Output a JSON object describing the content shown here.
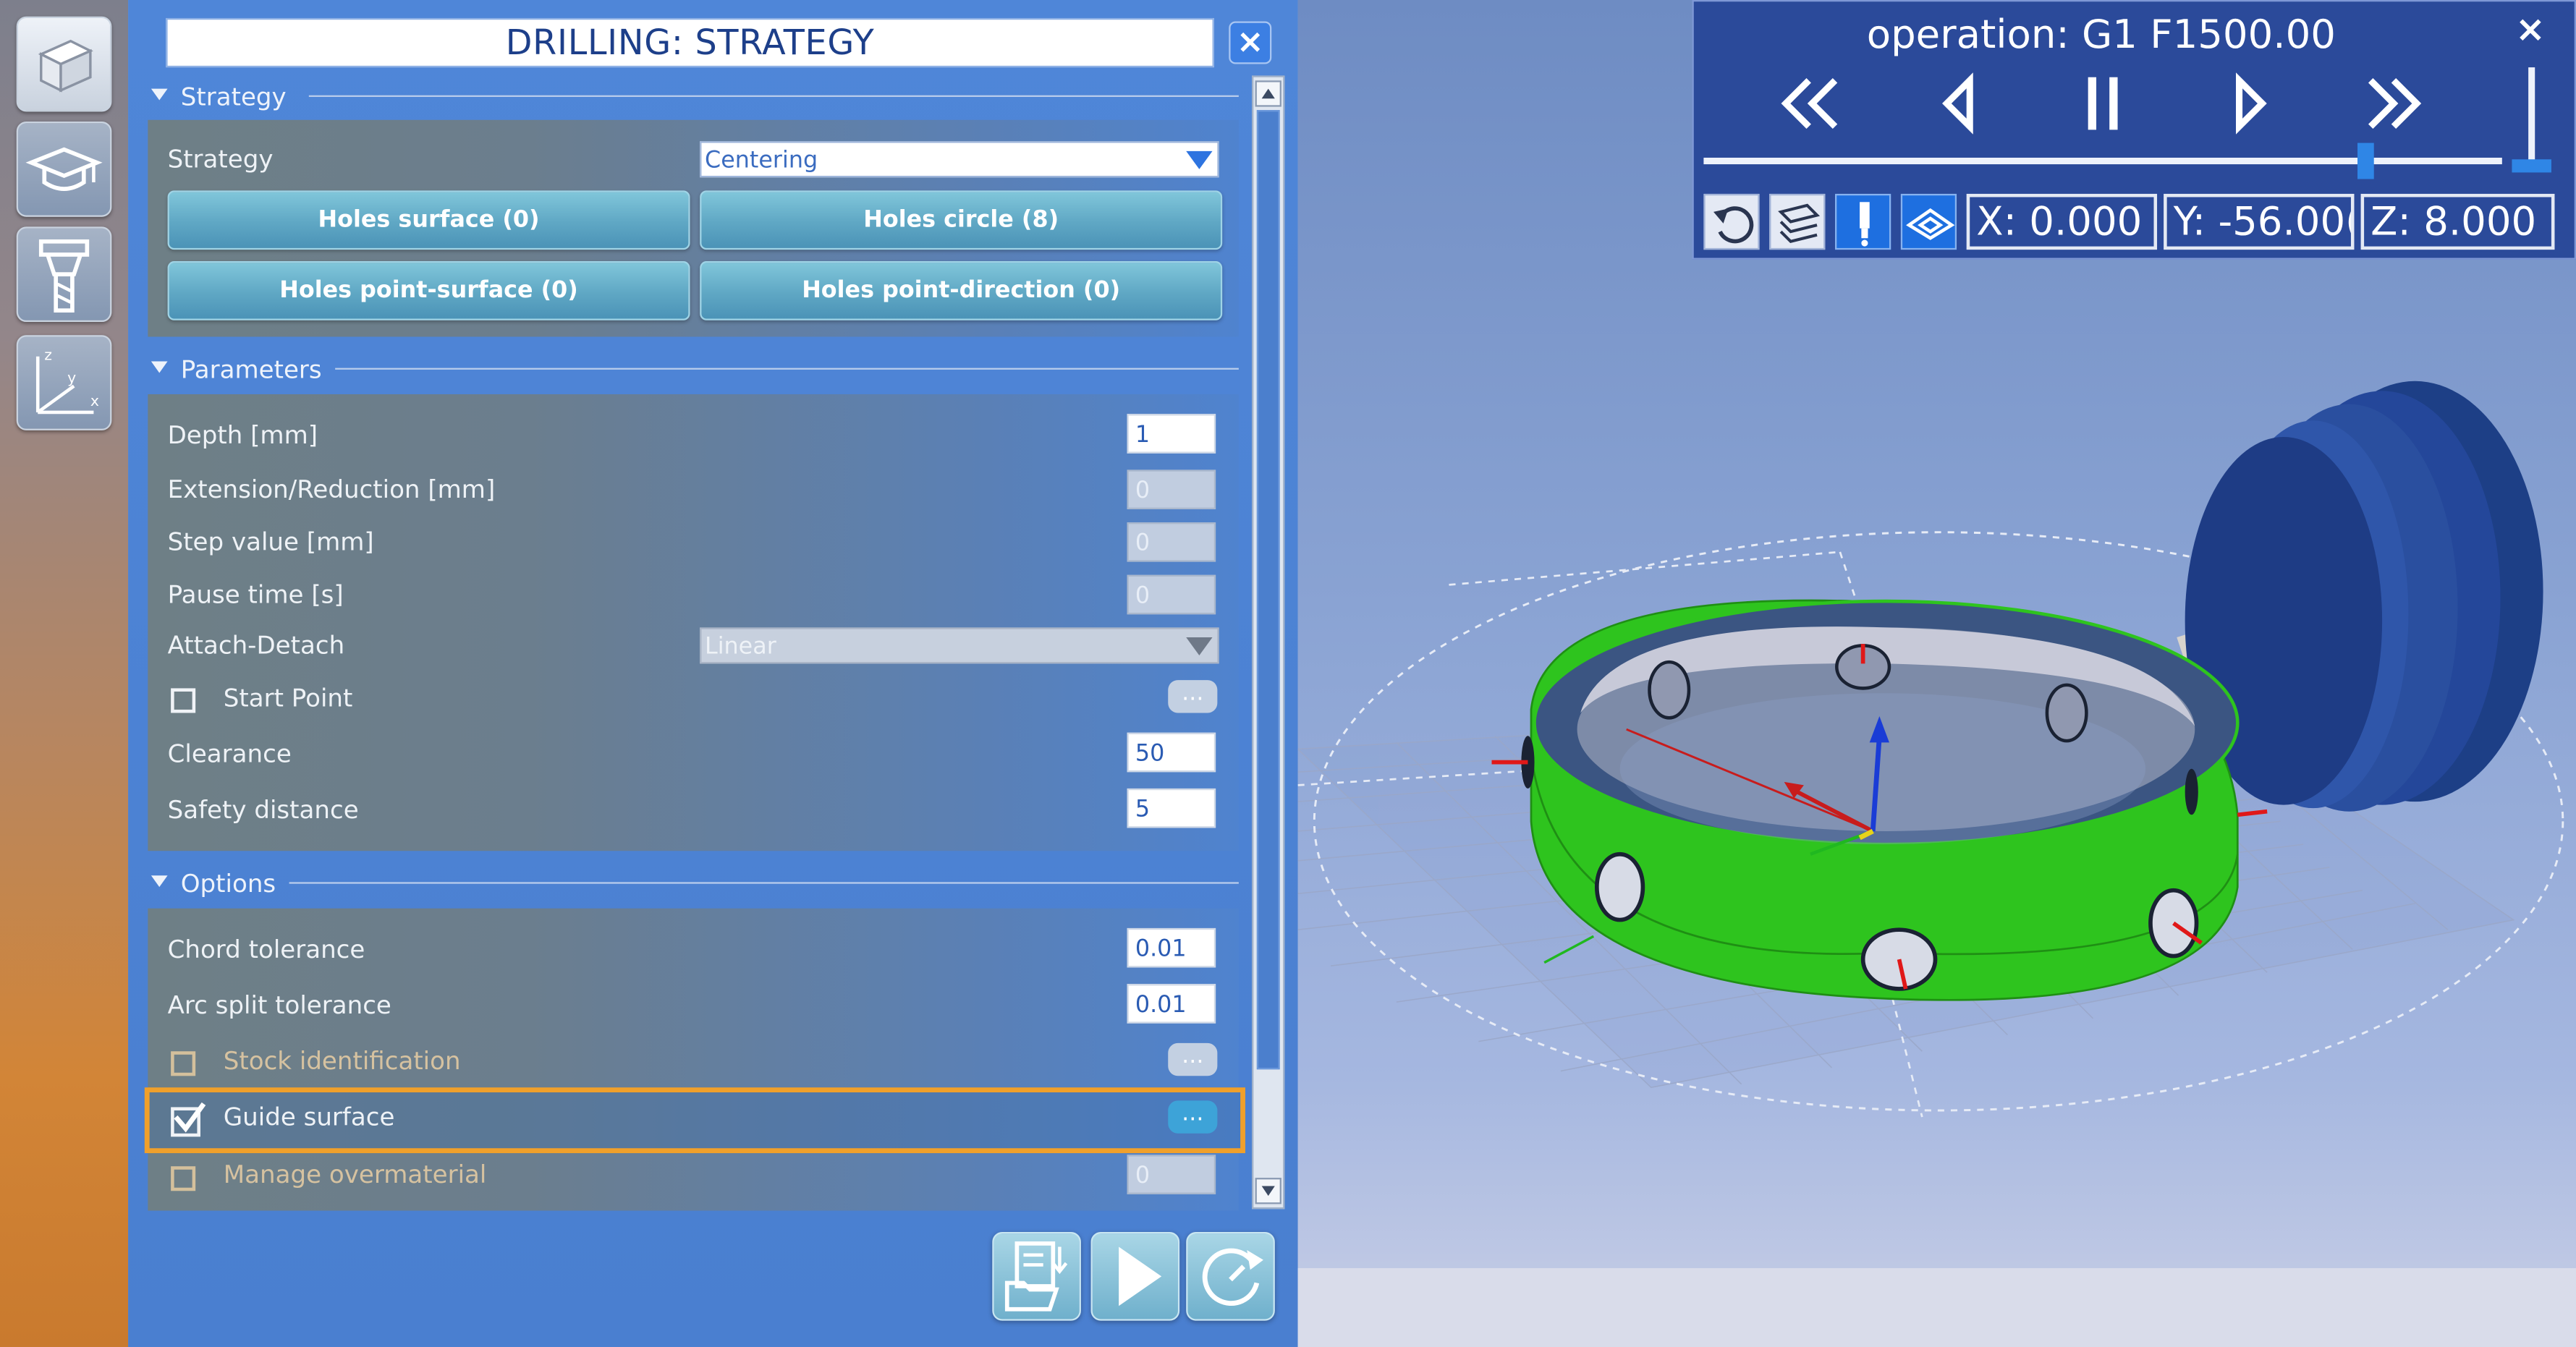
{
  "panel": {
    "title": "DRILLING: STRATEGY",
    "close_label": "×"
  },
  "sections": {
    "strategy": {
      "header": "Strategy",
      "strategy_label": "Strategy",
      "strategy_value": "Centering",
      "buttons": [
        "Holes surface (0)",
        "Holes circle (8)",
        "Holes point-surface (0)",
        "Holes point-direction (0)"
      ]
    },
    "parameters": {
      "header": "Parameters",
      "depth_label": "Depth [mm]",
      "depth_value": "1",
      "extension_label": "Extension/Reduction [mm]",
      "extension_value": "0",
      "step_label": "Step value [mm]",
      "step_value": "0",
      "pause_label": "Pause time [s]",
      "pause_value": "0",
      "attach_label": "Attach-Detach",
      "attach_value": "Linear",
      "start_point_label": "Start Point",
      "dots": "...",
      "clearance_label": "Clearance",
      "clearance_value": "50",
      "safety_label": "Safety distance",
      "safety_value": "5"
    },
    "options": {
      "header": "Options",
      "chord_label": "Chord tolerance",
      "chord_value": "0.01",
      "arc_label": "Arc split tolerance",
      "arc_value": "0.01",
      "stock_label": "Stock identification",
      "guide_label": "Guide surface",
      "guide_checked": true,
      "overmaterial_label": "Manage overmaterial",
      "overmaterial_value": "0",
      "dots": "..."
    }
  },
  "player": {
    "operation": "operation: G1 F1500.00",
    "close_label": "×",
    "x": "X: 0.000",
    "y": "Y: -56.00(",
    "z": "Z: 8.000",
    "progress": 0.83
  },
  "colors": {
    "panel_blue": "#4f86d8",
    "highlight_orange": "#f0a02b",
    "part_green": "#2ec41e",
    "player_bg": "#2b4a9a"
  }
}
